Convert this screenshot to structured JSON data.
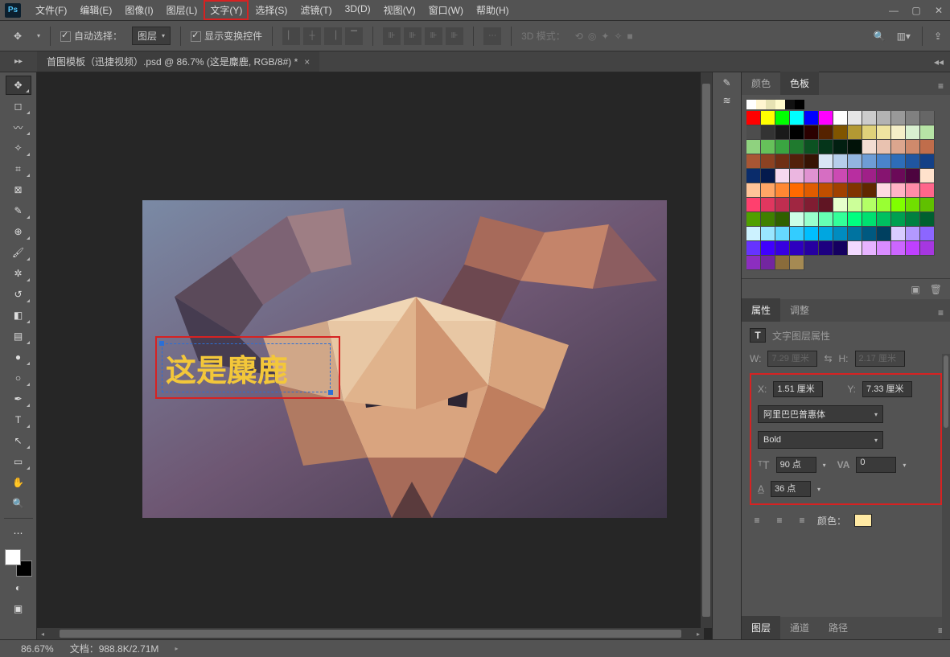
{
  "menu": {
    "items": [
      "文件(F)",
      "编辑(E)",
      "图像(I)",
      "图层(L)",
      "文字(Y)",
      "选择(S)",
      "滤镜(T)",
      "3D(D)",
      "视图(V)",
      "窗口(W)",
      "帮助(H)"
    ],
    "highlighted_index": 4
  },
  "options": {
    "auto_select": "自动选择：",
    "layer_combo": "图层",
    "show_transform": "显示变换控件",
    "mode_label": "3D 模式："
  },
  "document_tab": "首图模板（迅捷视频）.psd @ 86.7% (这是麋鹿, RGB/8#) *",
  "canvas_text": "这是麋鹿",
  "tools": [
    "move",
    "marquee",
    "lasso",
    "magic",
    "crop",
    "frame",
    "eyedropper",
    "heal",
    "brush",
    "clone",
    "history",
    "eraser",
    "gradient",
    "blur",
    "dodge",
    "pen",
    "type",
    "path",
    "shape",
    "hand",
    "zoom"
  ],
  "right_strip_icons": [
    "brush-settings",
    "brushes"
  ],
  "color_panel": {
    "tabs": [
      "颜色",
      "色板"
    ],
    "active": 1
  },
  "recent_swatches": [
    "#ffffff",
    "#fff5d0",
    "#e7e2b3",
    "#fffacc",
    "#111111",
    "#000000"
  ],
  "swatch_colors": [
    "#ff0000",
    "#ffff00",
    "#00ff00",
    "#00ffff",
    "#0000ff",
    "#ff00ff",
    "#ffffff",
    "#e6e6e6",
    "#cccccc",
    "#b3b3b3",
    "#999999",
    "#808080",
    "#666666",
    "#4d4d4d",
    "#333333",
    "#1a1a1a",
    "#000000",
    "#2b0000",
    "#552200",
    "#805500",
    "#b39933",
    "#e0d27a",
    "#efe4a0",
    "#f5efc8",
    "#d9f0d0",
    "#b7e4a6",
    "#8fd27f",
    "#66c15a",
    "#3aa541",
    "#1f7a2e",
    "#0c5222",
    "#05351a",
    "#021f11",
    "#011208",
    "#f3ddd2",
    "#e9c2b0",
    "#dca68e",
    "#cf8a6c",
    "#c06d4b",
    "#a85634",
    "#8c4222",
    "#6f2f14",
    "#52200b",
    "#361304",
    "#d9e6f5",
    "#b6ceeb",
    "#92b5e0",
    "#6e9dd6",
    "#4a84cc",
    "#2e6db8",
    "#2056a0",
    "#144086",
    "#0a2c6b",
    "#041a4d",
    "#f5d9ef",
    "#ebb6e0",
    "#e092d1",
    "#d66ec2",
    "#cc4ab3",
    "#b82ea0",
    "#a02088",
    "#861470",
    "#6b0a58",
    "#4d043f",
    "#ffe2cc",
    "#ffc499",
    "#ffa666",
    "#ff8833",
    "#ff6a00",
    "#e05c00",
    "#c04f00",
    "#a04100",
    "#803400",
    "#602700",
    "#ffd9e2",
    "#ffb3c5",
    "#ff8ca8",
    "#ff668b",
    "#ff406e",
    "#e0375f",
    "#c02e50",
    "#a02641",
    "#801d32",
    "#601523",
    "#e6ffcc",
    "#ccff99",
    "#b3ff66",
    "#99ff33",
    "#80ff00",
    "#70e000",
    "#60c000",
    "#50a000",
    "#408000",
    "#306000",
    "#ccffe6",
    "#99ffcc",
    "#66ffb3",
    "#33ff99",
    "#00ff80",
    "#00e070",
    "#00c060",
    "#00a050",
    "#008040",
    "#006030",
    "#ccf2ff",
    "#99e6ff",
    "#66d9ff",
    "#33ccff",
    "#00bfff",
    "#00a6e0",
    "#008cc0",
    "#0073a0",
    "#005980",
    "#004060",
    "#d9ccff",
    "#b399ff",
    "#8c66ff",
    "#6633ff",
    "#4000ff",
    "#3700e0",
    "#2e00c0",
    "#2600a0",
    "#1d0080",
    "#150060",
    "#f2d9ff",
    "#e6b3ff",
    "#d98cff",
    "#cc66ff",
    "#bf40ff",
    "#a637e0",
    "#8c2ec0",
    "#7326a0",
    "#8a6c3b",
    "#a58a53"
  ],
  "properties": {
    "tabs": [
      "属性",
      "调整"
    ],
    "title": "文字图层属性",
    "W_label": "W:",
    "W": "7.29 厘米",
    "H_label": "H:",
    "H": "2.17 厘米",
    "X_label": "X:",
    "X": "1.51 厘米",
    "Y_label": "Y:",
    "Y": "7.33 厘米",
    "font": "阿里巴巴普惠体",
    "weight": "Bold",
    "size": "90 点",
    "tracking": "0",
    "leading": "36 点",
    "color_label": "颜色："
  },
  "bottom_tabs": [
    "图层",
    "通道",
    "路径"
  ],
  "status": {
    "zoom": "86.67%",
    "doc": "文档：988.8K/2.71M"
  }
}
